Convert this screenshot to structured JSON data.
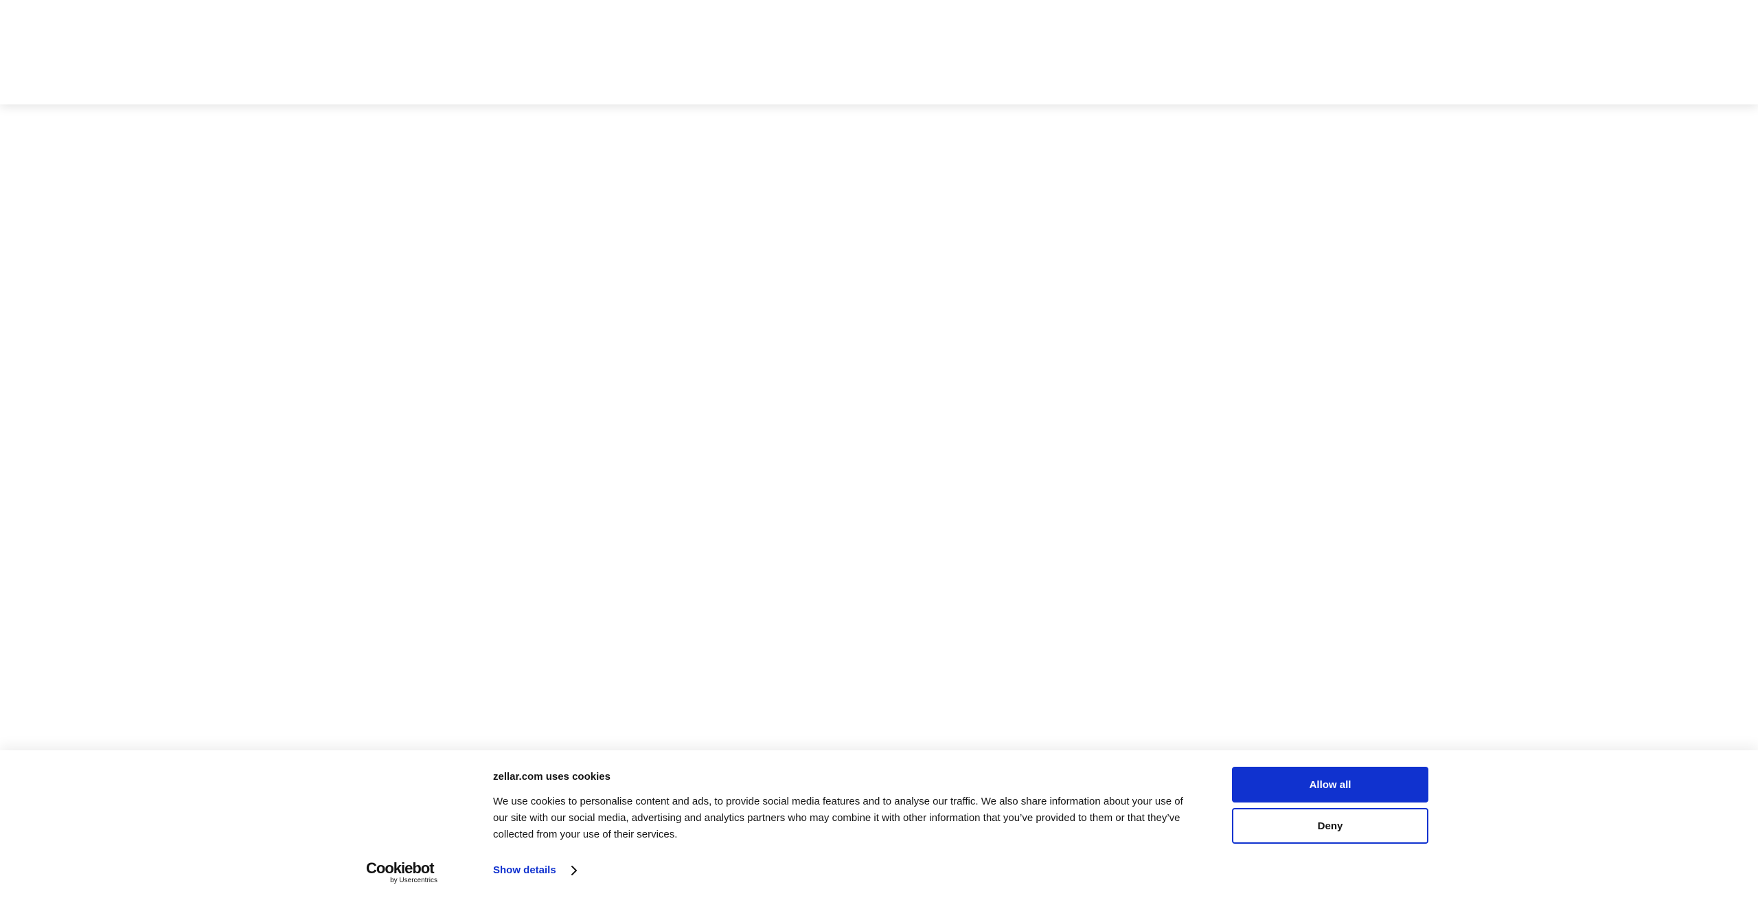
{
  "cookie_banner": {
    "title": "zellar.com uses cookies",
    "body": "We use cookies to personalise content and ads, to provide social media features and to analyse our traffic. We also share information about your use of our site with our social media, advertising and analytics partners who may combine it with other information that you’ve provided to them or that they’ve collected from your use of their services.",
    "show_details_label": "Show details",
    "allow_all_label": "Allow all",
    "deny_label": "Deny",
    "logo": {
      "brand": "Cookiebot",
      "sub": "by Usercentrics"
    },
    "colors": {
      "accent": "#1032cf",
      "text": "#141414"
    }
  }
}
